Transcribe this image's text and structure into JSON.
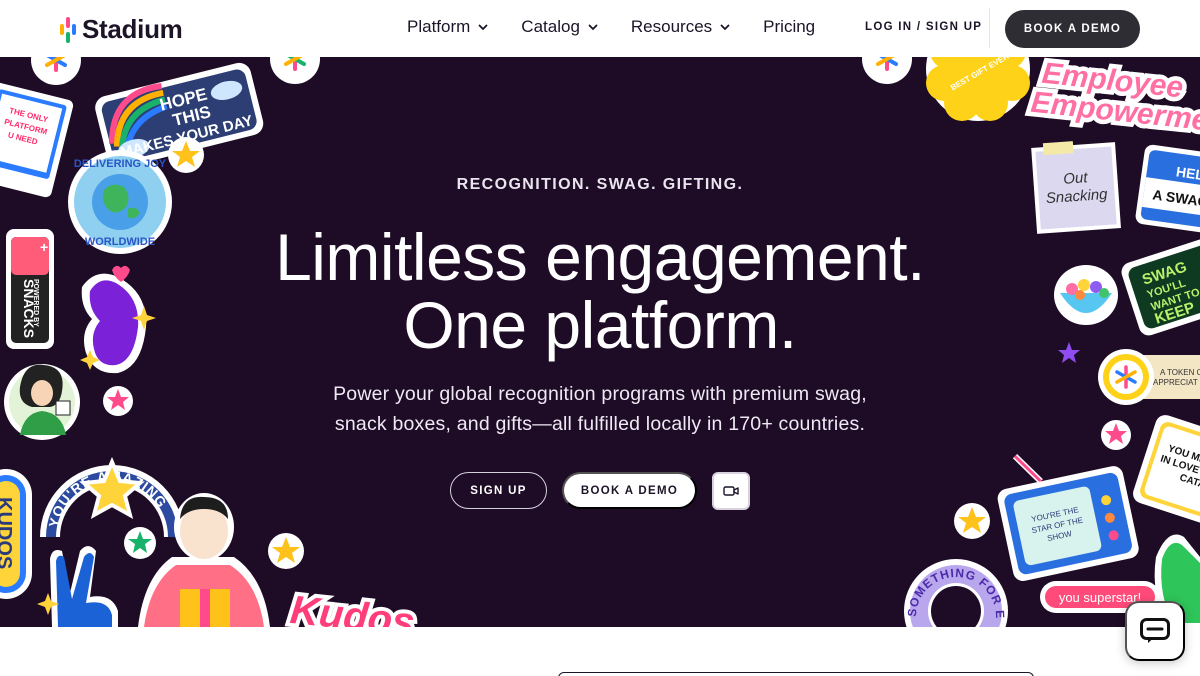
{
  "brand": {
    "name": "Stadium",
    "logo_colors": [
      "#ff4b8b",
      "#ffb000",
      "#2a7bff",
      "#18b26b"
    ]
  },
  "nav": {
    "menu": [
      {
        "label": "Platform",
        "has_dropdown": true
      },
      {
        "label": "Catalog",
        "has_dropdown": true
      },
      {
        "label": "Resources",
        "has_dropdown": true
      },
      {
        "label": "Pricing",
        "has_dropdown": false
      }
    ],
    "login_label": "LOG IN / SIGN UP",
    "demo_label": "BOOK A DEMO"
  },
  "hero": {
    "eyebrow": "RECOGNITION. SWAG. GIFTING.",
    "headline_line1": "Limitless engagement.",
    "headline_line2": "One platform.",
    "subtext_line1": "Power your global recognition programs with premium swag,",
    "subtext_line2": "snack boxes, and gifts—all fulfilled locally in 170+ countries.",
    "signup_label": "SIGN UP",
    "demo_label": "BOOK A DEMO",
    "video_icon": "video-camera-icon"
  },
  "stickers": {
    "hope": [
      "HOPE",
      "THIS",
      "MAKES YOUR DAY"
    ],
    "delivering": [
      "DELIVERING JOY",
      "WORLDWIDE"
    ],
    "snacks": [
      "POWERED BY",
      "SNACKS"
    ],
    "amazing": "YOU'RE AMAZING",
    "kudos_vertical": "KUDOS",
    "kudos_script": "Kudos",
    "platform_laptop": [
      "THE ONLY",
      "PLATFORM",
      "U NEED"
    ],
    "employee": [
      "Employee",
      "Empowerment"
    ],
    "out_snacking": [
      "Out",
      "Snacking"
    ],
    "hello": [
      "HELL",
      "A SWAG"
    ],
    "swag_keep": [
      "SWAG",
      "YOU'LL",
      "WANT TO",
      "KEEP"
    ],
    "token": [
      "A TOKEN O",
      "APPRECIAT"
    ],
    "love_catalog": [
      "YOU MI",
      "IN LOVE W",
      "CATA"
    ],
    "tv": [
      "YOU'RE THE",
      "STAR OF THE",
      "SHOW"
    ],
    "superstar": "you superstar!",
    "something": "SOMETHING FOR EV",
    "best_gift": "BEST GIFT EVER"
  },
  "colors": {
    "hero_bg": "#1e0c26",
    "nav_text": "#1d1428",
    "dark_button": "#2d2d33"
  },
  "chat": {
    "icon": "chat-bubble-icon"
  }
}
